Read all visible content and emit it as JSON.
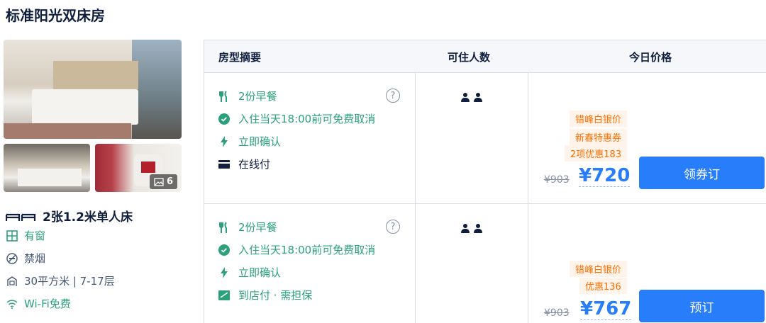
{
  "room": {
    "title": "标准阳光双床房",
    "photo_count": "6",
    "bed": "2张1.2米单人床",
    "amenities": [
      {
        "icon": "window-icon",
        "text": "有窗"
      },
      {
        "icon": "no-smoking-icon",
        "text": "禁烟"
      },
      {
        "icon": "area-icon",
        "text": "30平方米 | 7-17层"
      },
      {
        "icon": "wifi-icon",
        "text": "Wi-Fi免费"
      }
    ]
  },
  "table": {
    "headers": [
      "房型摘要",
      "可住人数",
      "今日价格"
    ],
    "rows": [
      {
        "features": [
          "2份早餐",
          "入住当天18:00前可免费取消",
          "立即确认",
          "在线付"
        ],
        "help": "?",
        "promos": [
          "错峰白银价",
          "新春特惠券",
          "2项优惠183"
        ],
        "old_price": "¥903",
        "price": "¥720",
        "button": "领券订"
      },
      {
        "features": [
          "2份早餐",
          "入住当天18:00前可免费取消",
          "立即确认",
          "到店付 · 需担保"
        ],
        "help": "?",
        "promos": [
          "错峰白银价",
          "优惠136"
        ],
        "old_price": "¥903",
        "price": "¥767",
        "button": "预订"
      }
    ]
  },
  "colors": {
    "accent": "#287dfa",
    "green": "#2aa17b",
    "promo": "#ff6f00"
  }
}
